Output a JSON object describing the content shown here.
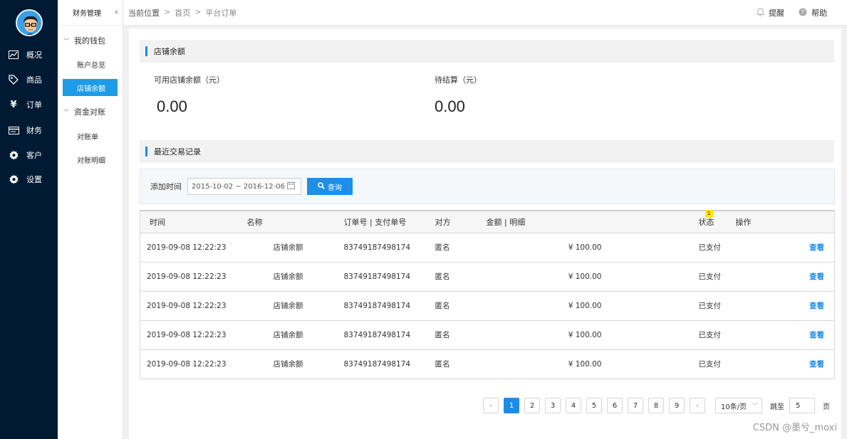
{
  "sidebar": {
    "items": [
      {
        "label": "概况",
        "icon": "chart-icon"
      },
      {
        "label": "商品",
        "icon": "tag-icon"
      },
      {
        "label": "订单",
        "icon": "yen-icon"
      },
      {
        "label": "财务",
        "icon": "card-icon"
      },
      {
        "label": "客户",
        "icon": "gear-icon"
      },
      {
        "label": "设置",
        "icon": "gear-icon"
      }
    ]
  },
  "subnav": {
    "title": "财务管理",
    "groups": [
      {
        "label": "我的钱包",
        "items": [
          "账户总览",
          "店铺余额"
        ]
      },
      {
        "label": "资金对账",
        "items": [
          "对账单",
          "对账明细"
        ]
      }
    ],
    "active_item": "店铺余额"
  },
  "topbar": {
    "crumbs": [
      "当前位置",
      "首页",
      "平台订单"
    ],
    "remind": "提醒",
    "help": "帮助"
  },
  "balance": {
    "section_title": "店铺余额",
    "available_label": "可用店铺余额（元）",
    "available_value": "0.00",
    "pending_label": "待结算（元）",
    "pending_value": "0.00"
  },
  "records": {
    "section_title": "最近交易记录",
    "filter_label": "添加时间",
    "date_range": "2015-10-02 ~ 2016-12-06",
    "query_label": "查询",
    "columns": [
      "时间",
      "名称",
      "订单号 | 支付单号",
      "对方",
      "金额 | 明细",
      "状态",
      "操作"
    ],
    "status_badge": "1",
    "rows": [
      {
        "time": "2019-09-08  12:22:23",
        "name": "店铺余额",
        "order": "83749187498174",
        "party": "匿名",
        "amount": "¥ 100.00",
        "status": "已支付",
        "op": "查看"
      },
      {
        "time": "2019-09-08  12:22:23",
        "name": "店铺余额",
        "order": "83749187498174",
        "party": "匿名",
        "amount": "¥ 100.00",
        "status": "已支付",
        "op": "查看"
      },
      {
        "time": "2019-09-08  12:22:23",
        "name": "店铺余额",
        "order": "83749187498174",
        "party": "匿名",
        "amount": "¥ 100.00",
        "status": "已支付",
        "op": "查看"
      },
      {
        "time": "2019-09-08  12:22:23",
        "name": "店铺余额",
        "order": "83749187498174",
        "party": "匿名",
        "amount": "¥ 100.00",
        "status": "已支付",
        "op": "查看"
      },
      {
        "time": "2019-09-08  12:22:23",
        "name": "店铺余额",
        "order": "83749187498174",
        "party": "匿名",
        "amount": "¥ 100.00",
        "status": "已支付",
        "op": "查看"
      }
    ]
  },
  "pagination": {
    "prev": "‹",
    "next": "›",
    "pages": [
      "1",
      "2",
      "3",
      "4",
      "5",
      "6",
      "7",
      "8",
      "9"
    ],
    "current": "1",
    "page_size": "10条/页",
    "jump_label": "跳至",
    "jump_value": "5",
    "page_unit": "页"
  },
  "watermark": "CSDN @墨兮_moxi",
  "colors": {
    "sidebar_bg": "#001a33",
    "accent": "#1d8ce8"
  }
}
